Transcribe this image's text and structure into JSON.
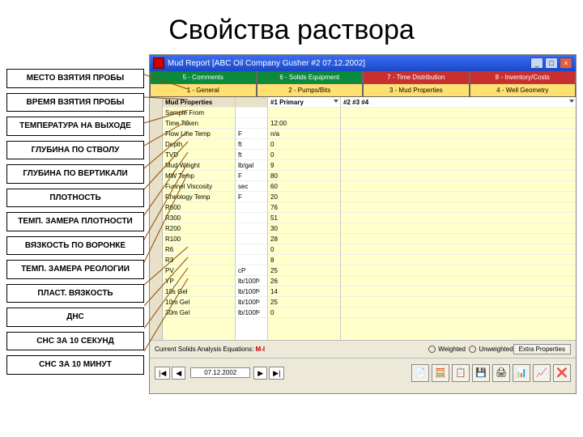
{
  "title": "Свойства раствора",
  "labels": [
    "МЕСТО ВЗЯТИЯ ПРОБЫ",
    "ВРЕМЯ ВЗЯТИЯ ПРОБЫ",
    "ТЕМПЕРАТУРА НА ВЫХОДЕ",
    "ГЛУБИНА ПО СТВОЛУ",
    "ГЛУБИНА ПО ВЕРТИКАЛИ",
    "ПЛОТНОСТЬ",
    "ТЕМП. ЗАМЕРА ПЛОТНОСТИ",
    "ВЯЗКОСТЬ ПО ВОРОНКЕ",
    "ТЕМП. ЗАМЕРА РЕОЛОГИИ",
    "ПЛАСТ. ВЯЗКОСТЬ",
    "ДНС",
    "СНС ЗА 10 СЕКУНД",
    "СНС ЗА 10 МИНУТ"
  ],
  "titlebar": {
    "text": "Mud Report [ABC Oil Company  Gusher #2  07.12.2002]",
    "min": "_",
    "max": "□",
    "close": "×"
  },
  "tabs_top": [
    {
      "label": "5 - Comments",
      "cls": "t-green"
    },
    {
      "label": "6 - Solids Equipment",
      "cls": "t-green"
    },
    {
      "label": "7 - Time Distribution",
      "cls": "t-red"
    },
    {
      "label": "8 - Inventory/Costs",
      "cls": "t-red"
    }
  ],
  "tabs_bot": [
    {
      "label": "1 - General",
      "cls": "t-ylw"
    },
    {
      "label": "2 - Pumps/Bits",
      "cls": "t-ylw"
    },
    {
      "label": "3 - Mud Properties",
      "cls": "t-ylw"
    },
    {
      "label": "4 - Well Geometry",
      "cls": "t-ylw"
    }
  ],
  "grid": {
    "header_row": {
      "c1": "Mud Properties",
      "c2": "",
      "c3": "#1  Primary",
      "c4": "#2                    #3                    #4"
    },
    "rows": [
      {
        "p": "Sample From",
        "u": "",
        "v": ""
      },
      {
        "p": "Time Taken",
        "u": "",
        "v": "12:00"
      },
      {
        "p": "Flow Line Temp",
        "u": "F",
        "v": "n/a"
      },
      {
        "p": "Depth",
        "u": "ft",
        "v": "0"
      },
      {
        "p": "TVD",
        "u": "ft",
        "v": "0"
      },
      {
        "p": "Mud Weight",
        "u": "lb/gal",
        "v": "9"
      },
      {
        "p": "MW Temp",
        "u": "F",
        "v": "80"
      },
      {
        "p": "Funnel Viscosity",
        "u": "sec",
        "v": "60"
      },
      {
        "p": "Rheology Temp",
        "u": "F",
        "v": "20"
      },
      {
        "p": "R600",
        "u": "",
        "v": "76"
      },
      {
        "p": "R300",
        "u": "",
        "v": "51"
      },
      {
        "p": "R200",
        "u": "",
        "v": "30"
      },
      {
        "p": "R100",
        "u": "",
        "v": "28"
      },
      {
        "p": "R6",
        "u": "",
        "v": "0"
      },
      {
        "p": "R3",
        "u": "",
        "v": "8"
      },
      {
        "p": "PV",
        "u": "cP",
        "v": "25"
      },
      {
        "p": "YP",
        "u": "lb/100f²",
        "v": "26"
      },
      {
        "p": "10s Gel",
        "u": "lb/100f²",
        "v": "14"
      },
      {
        "p": "10m Gel",
        "u": "lb/100f²",
        "v": "25"
      },
      {
        "p": "30m Gel",
        "u": "lb/100f²",
        "v": "0"
      }
    ]
  },
  "footer1": {
    "eq_label": "Current Solids Analysis Equations:",
    "mi": "M-I",
    "weighted": "Weighted",
    "unweighted": "Unweighted",
    "extra": "Extra Properties"
  },
  "footer2": {
    "first": "|◀",
    "prev": "◀",
    "date": "07.12.2002",
    "next": "▶",
    "last": "▶|",
    "icons": [
      "📄",
      "🧮",
      "📋",
      "💾",
      "🖨",
      "📊",
      "📈",
      "❌"
    ]
  }
}
